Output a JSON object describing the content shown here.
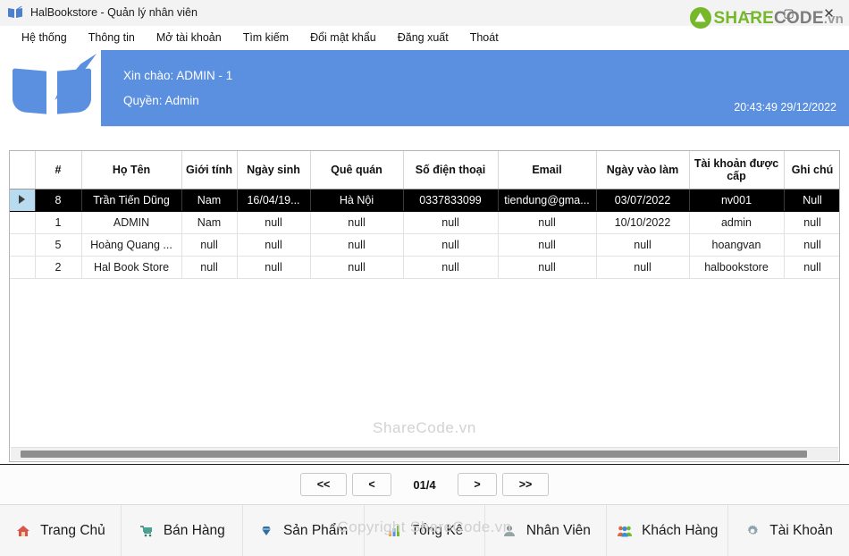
{
  "window": {
    "title": "HalBookstore - Quản lý nhân viên",
    "icon": "book-icon",
    "minimize": "–",
    "maximize": "▢",
    "close": "✕"
  },
  "watermark": {
    "logo_a": "SHARE",
    "logo_b": "CODE",
    "logo_c": ".vn",
    "grid_text": "ShareCode.vn",
    "bottom_text": "Copyright ShareCode.vn",
    "brand_color": "#76b82a"
  },
  "menubar": {
    "items": [
      {
        "label": "Hệ thống"
      },
      {
        "label": "Thông tin"
      },
      {
        "label": "Mở tài khoản"
      },
      {
        "label": "Tìm kiếm"
      },
      {
        "label": "Đổi mật khẩu"
      },
      {
        "label": "Đăng xuất"
      },
      {
        "label": "Thoát"
      }
    ]
  },
  "banner": {
    "greeting": "Xin chào: ADMIN - 1",
    "role": "Quyền: Admin",
    "clock": "20:43:49 29/12/2022",
    "accent_color": "#5b8fe0"
  },
  "grid": {
    "columns": [
      {
        "key": "rowhdr",
        "label": ""
      },
      {
        "key": "num",
        "label": "#"
      },
      {
        "key": "hoten",
        "label": "Họ Tên"
      },
      {
        "key": "gioitinh",
        "label": "Giới tính"
      },
      {
        "key": "ngaysinh",
        "label": "Ngày sinh"
      },
      {
        "key": "quequan",
        "label": "Quê quán"
      },
      {
        "key": "sodienthoai",
        "label": "Số điện thoại"
      },
      {
        "key": "email",
        "label": "Email"
      },
      {
        "key": "ngayvaolam",
        "label": "Ngày vào làm"
      },
      {
        "key": "taikhoan",
        "label": "Tài khoản được cấp"
      },
      {
        "key": "ghichu",
        "label": "Ghi chú"
      }
    ],
    "rows": [
      {
        "selected": true,
        "num": "8",
        "hoten": "Trần Tiến Dũng",
        "gioitinh": "Nam",
        "ngaysinh": "16/04/19...",
        "quequan": "Hà Nội",
        "sodienthoai": "0337833099",
        "email": "tiendung@gma...",
        "ngayvaolam": "03/07/2022",
        "taikhoan": "nv001",
        "ghichu": "Null"
      },
      {
        "selected": false,
        "num": "1",
        "hoten": "ADMIN",
        "gioitinh": "Nam",
        "ngaysinh": "null",
        "quequan": "null",
        "sodienthoai": "null",
        "email": "null",
        "ngayvaolam": "10/10/2022",
        "taikhoan": "admin",
        "ghichu": "null"
      },
      {
        "selected": false,
        "num": "5",
        "hoten": "Hoàng Quang ...",
        "gioitinh": "null",
        "ngaysinh": "null",
        "quequan": "null",
        "sodienthoai": "null",
        "email": "null",
        "ngayvaolam": "null",
        "taikhoan": "hoangvan",
        "ghichu": "null"
      },
      {
        "selected": false,
        "num": "2",
        "hoten": "Hal Book Store",
        "gioitinh": "null",
        "ngaysinh": "null",
        "quequan": "null",
        "sodienthoai": "null",
        "email": "null",
        "ngayvaolam": "null",
        "taikhoan": "halbookstore",
        "ghichu": "null"
      }
    ]
  },
  "pager": {
    "first": "<<",
    "prev": "<",
    "page_label": "01/4",
    "next": ">",
    "last": ">>"
  },
  "bottomnav": {
    "items": [
      {
        "label": "Trang Chủ",
        "icon": "home-icon",
        "glyph": "⌂"
      },
      {
        "label": "Bán Hàng",
        "icon": "cart-icon",
        "glyph": "Ὥ2"
      },
      {
        "label": "Sản Phẩm",
        "icon": "diamond-icon",
        "glyph": "◆"
      },
      {
        "label": "Tổng Kê",
        "icon": "chart-icon",
        "glyph": "▤"
      },
      {
        "label": "Nhân Viên",
        "icon": "badge-icon",
        "glyph": "◎"
      },
      {
        "label": "Khách Hàng",
        "icon": "people-icon",
        "glyph": "♟"
      },
      {
        "label": "Tài Khoản",
        "icon": "gear-icon",
        "glyph": "⚙"
      }
    ]
  }
}
